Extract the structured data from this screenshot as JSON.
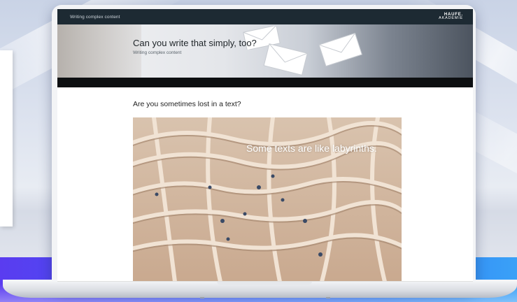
{
  "app": {
    "window_title": "Writing complex content",
    "logo_top": "HAUFE.",
    "logo_bottom": "AKADEMIE"
  },
  "hero": {
    "title": "Can you write that simply, too?",
    "subtitle": "Writing complex content",
    "icons": [
      "envelope-icon",
      "envelope-icon",
      "envelope-icon"
    ]
  },
  "content": {
    "heading": "Are you sometimes lost in a text?",
    "image_caption": "Some texts are like labyrinths."
  },
  "colors": {
    "topbar": "#1d2a33",
    "accent_band_start": "#5a3cf0",
    "accent_band_end": "#3aa1f7"
  }
}
